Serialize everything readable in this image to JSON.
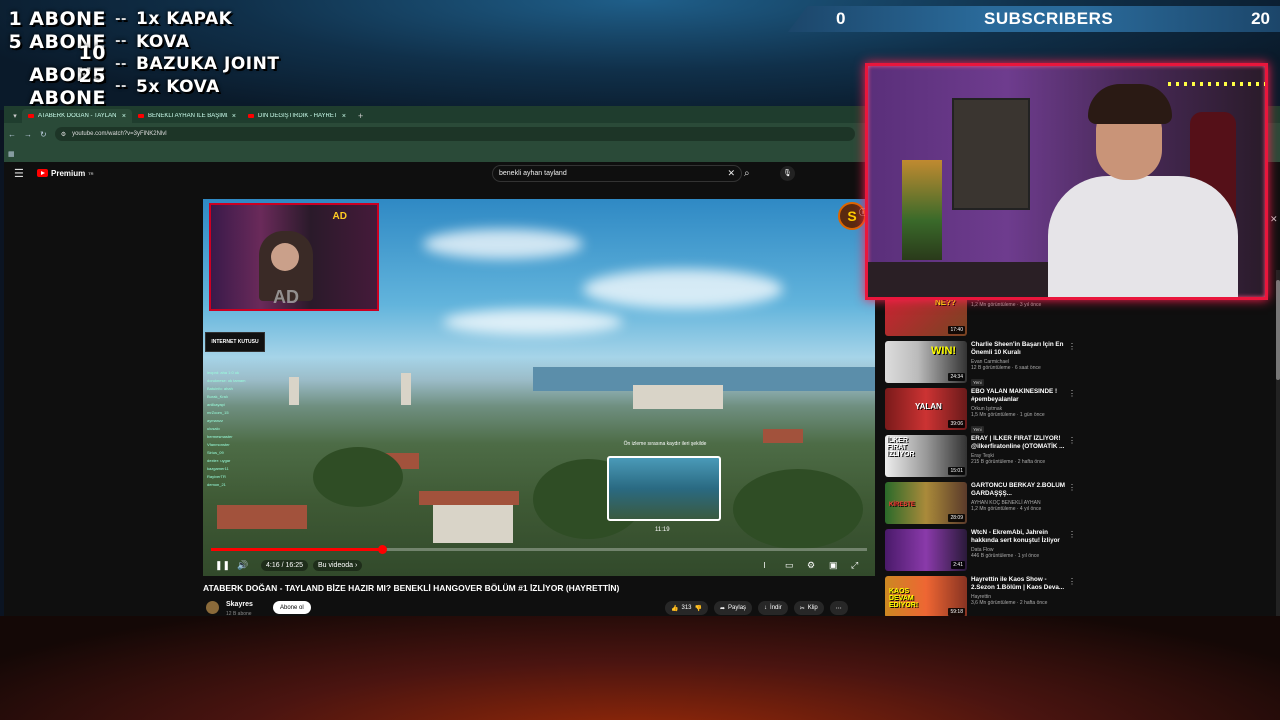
{
  "overlay": {
    "goals": [
      {
        "level": "1 ABONE",
        "sep": "--",
        "reward": "1x KAPAK"
      },
      {
        "level": "5 ABONE",
        "sep": "--",
        "reward": "KOVA"
      },
      {
        "level": "10 ABONE",
        "sep": "--",
        "reward": "BAZUKA JOINT"
      },
      {
        "level": "25 ABONE",
        "sep": "--",
        "reward": "5x KOVA"
      }
    ],
    "subscribers": {
      "current": "0",
      "label": "SUBSCRIBERS",
      "goal": "20"
    }
  },
  "browser": {
    "tabs": [
      {
        "label": "ATABERK DOĞAN - TAYLAN"
      },
      {
        "label": "BENEKLİ AYHAN İLE BAŞIMIZA"
      },
      {
        "label": "DİN DEĞİŞTİRDİK - HAYRETTİN"
      }
    ],
    "new_tab": "+",
    "url": "youtube.com/watch?v=3yFlNK2Nlvl"
  },
  "youtube": {
    "logo_text": "Premium",
    "logo_sup": "TR",
    "search_value": "benekli ayhan tayland",
    "player": {
      "inset_logo": "AD",
      "badge": "INTERNET KUTUSU",
      "chat_lines": [
        "leoprd: aha 1:0 ok",
        "doruknese: ok tamam",
        "Batuinfo: ahah",
        "Burak_Kralı",
        "anilkayapi",
        "mrZoom_15",
        "aymanzz",
        "ulusalo",
        "hermesmaster",
        "Vfanmonster",
        "Sirius_09",
        "dexter: uygar",
        "kazgamer11",
        "RayiverTR",
        "demon_21",
        "ForgoHappy",
        "Samoa3"
      ],
      "preview_hint": "Ön izleme sırasına kaydır ileri şekilde",
      "preview_time": "11:19",
      "channel_badge": "S",
      "time": "4:16 / 16:25",
      "chapter": "Bu videoda ›",
      "progress": 0.26
    },
    "title": "ATABERK DOĞAN - TAYLAND BİZE HAZIR MI? BENEKLİ HANGOVER BÖLÜM #1 İZLİYOR (HAYRETTİN)",
    "channel": {
      "name": "Skayres",
      "subs": "12 B abone",
      "subscribe": "Abone ol"
    },
    "actions": {
      "likes": "313",
      "share": "Paylaş",
      "download": "İndir",
      "clip": "Klip"
    }
  },
  "sidebar": [
    {
      "title": "",
      "channel": "Hayrettin",
      "stats": "1,2 Mn görüntüleme · 3 yıl önce",
      "duration": "17:40",
      "tag": "",
      "thumb_text": "NE??"
    },
    {
      "title": "Charlie Sheen'in Başarı İçin En Önemli 10 Kuralı",
      "channel": "Evan Carmichael",
      "stats": "12 B görüntüleme · 6 saat önce",
      "duration": "24:34",
      "tag": "Yeni",
      "thumb_text": "WIN!"
    },
    {
      "title": "EBO YALAN MAKİNESİNDE ! #pembeyalanlar",
      "channel": "Orkun Işıtmak",
      "stats": "1,5 Mn görüntüleme · 1 gün önce",
      "duration": "39:06",
      "tag": "Yeni",
      "thumb_text": "YALAN"
    },
    {
      "title": "ERAY | İLKER FIRAT İZLİYOR! @ilkerfiratonline (OTOMATİK ...",
      "channel": "Eray Teşki",
      "stats": "215 B görüntüleme · 2 hafta önce",
      "duration": "15:01",
      "tag": "",
      "thumb_text": "İLKER FIRAT İZLİYOR"
    },
    {
      "title": "GARTONCU BERKAY 2.BÖLÜM GARDAŞŞŞ...",
      "channel": "AYHAN KOÇ BENEKLİ AYHAN",
      "stats": "1,2 Mn görüntüleme · 4 yıl önce",
      "duration": "28:09",
      "tag": "",
      "thumb_text": "KİRESTE"
    },
    {
      "title": "WtcN - EkremAbi, Jahrein hakkında sert konuştu! İzliyor",
      "channel": "Data Flow",
      "stats": "446 B görüntüleme · 1 yıl önce",
      "duration": "2:41",
      "tag": "",
      "thumb_text": ""
    },
    {
      "title": "Hayrettin ile Kaos Show - 2.Sezon 1.Bölüm | Kaos Deva...",
      "channel": "Hayrettin",
      "stats": "3,6 Mn görüntüleme · 2 hafta önce",
      "duration": "59:18",
      "tag": "",
      "thumb_text": "KAOS DEVAM EDİYOR!"
    }
  ]
}
